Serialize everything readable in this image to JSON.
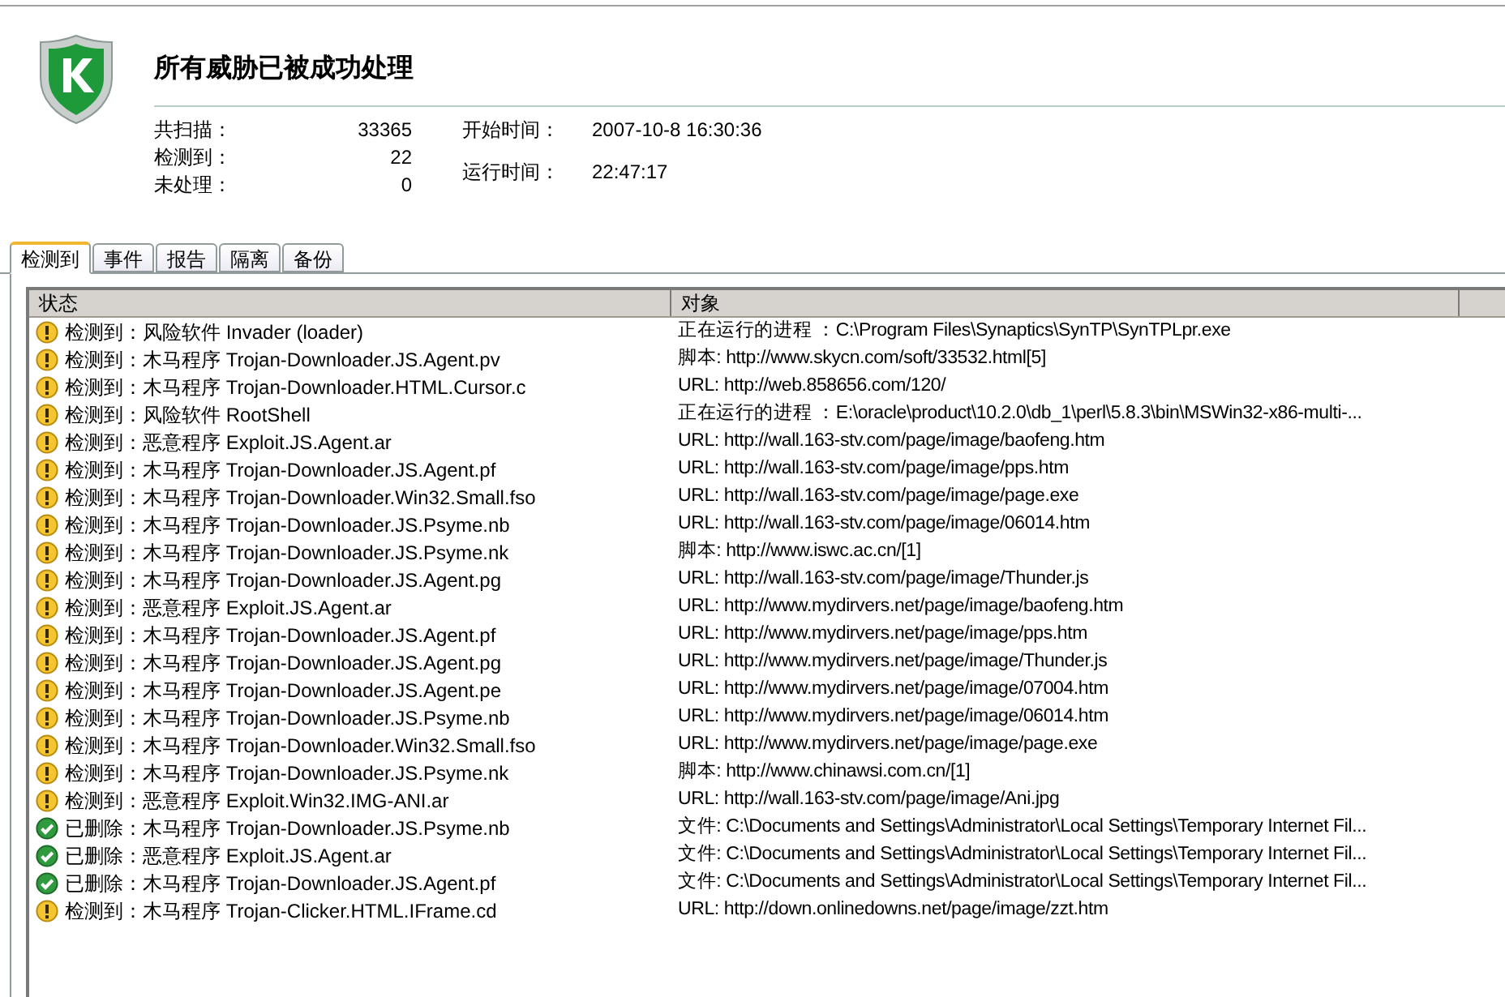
{
  "title": "所有威胁已被成功处理",
  "stats": [
    {
      "label": "共扫描：",
      "value": "33365"
    },
    {
      "label": "检测到：",
      "value": "22"
    },
    {
      "label": "未处理：",
      "value": "0"
    }
  ],
  "times": [
    {
      "label": "开始时间：",
      "value": "2007-10-8 16:30:36"
    },
    {
      "label": "运行时间：",
      "value": "22:47:17"
    }
  ],
  "tabs": [
    {
      "label": "检测到",
      "selected": true
    },
    {
      "label": "事件",
      "selected": false
    },
    {
      "label": "报告",
      "selected": false
    },
    {
      "label": "隔离",
      "selected": false
    },
    {
      "label": "备份",
      "selected": false
    }
  ],
  "table": {
    "columns": [
      "状态",
      "对象"
    ],
    "rows": [
      {
        "kind": "detected",
        "status": "检测到：风险软件 Invader (loader)",
        "object": "正在运行的进程 ：C:\\Program Files\\Synaptics\\SynTP\\SynTPLpr.exe"
      },
      {
        "kind": "detected",
        "status": "检测到：木马程序 Trojan-Downloader.JS.Agent.pv",
        "object": "脚本: http://www.skycn.com/soft/33532.html[5]"
      },
      {
        "kind": "detected",
        "status": "检测到：木马程序 Trojan-Downloader.HTML.Cursor.c",
        "object": "URL: http://web.858656.com/120/"
      },
      {
        "kind": "detected",
        "status": "检测到：风险软件 RootShell",
        "object": "正在运行的进程 ：E:\\oracle\\product\\10.2.0\\db_1\\perl\\5.8.3\\bin\\MSWin32-x86-multi-..."
      },
      {
        "kind": "detected",
        "status": "检测到：恶意程序 Exploit.JS.Agent.ar",
        "object": "URL: http://wall.163-stv.com/page/image/baofeng.htm"
      },
      {
        "kind": "detected",
        "status": "检测到：木马程序 Trojan-Downloader.JS.Agent.pf",
        "object": "URL: http://wall.163-stv.com/page/image/pps.htm"
      },
      {
        "kind": "detected",
        "status": "检测到：木马程序 Trojan-Downloader.Win32.Small.fso",
        "object": "URL: http://wall.163-stv.com/page/image/page.exe"
      },
      {
        "kind": "detected",
        "status": "检测到：木马程序 Trojan-Downloader.JS.Psyme.nb",
        "object": "URL: http://wall.163-stv.com/page/image/06014.htm"
      },
      {
        "kind": "detected",
        "status": "检测到：木马程序 Trojan-Downloader.JS.Psyme.nk",
        "object": "脚本: http://www.iswc.ac.cn/[1]"
      },
      {
        "kind": "detected",
        "status": "检测到：木马程序 Trojan-Downloader.JS.Agent.pg",
        "object": "URL: http://wall.163-stv.com/page/image/Thunder.js"
      },
      {
        "kind": "detected",
        "status": "检测到：恶意程序 Exploit.JS.Agent.ar",
        "object": "URL: http://www.mydirvers.net/page/image/baofeng.htm"
      },
      {
        "kind": "detected",
        "status": "检测到：木马程序 Trojan-Downloader.JS.Agent.pf",
        "object": "URL: http://www.mydirvers.net/page/image/pps.htm"
      },
      {
        "kind": "detected",
        "status": "检测到：木马程序 Trojan-Downloader.JS.Agent.pg",
        "object": "URL: http://www.mydirvers.net/page/image/Thunder.js"
      },
      {
        "kind": "detected",
        "status": "检测到：木马程序 Trojan-Downloader.JS.Agent.pe",
        "object": "URL: http://www.mydirvers.net/page/image/07004.htm"
      },
      {
        "kind": "detected",
        "status": "检测到：木马程序 Trojan-Downloader.JS.Psyme.nb",
        "object": "URL: http://www.mydirvers.net/page/image/06014.htm"
      },
      {
        "kind": "detected",
        "status": "检测到：木马程序 Trojan-Downloader.Win32.Small.fso",
        "object": "URL: http://www.mydirvers.net/page/image/page.exe"
      },
      {
        "kind": "detected",
        "status": "检测到：木马程序 Trojan-Downloader.JS.Psyme.nk",
        "object": "脚本: http://www.chinawsi.com.cn/[1]"
      },
      {
        "kind": "detected",
        "status": "检测到：恶意程序 Exploit.Win32.IMG-ANI.ar",
        "object": "URL: http://wall.163-stv.com/page/image/Ani.jpg"
      },
      {
        "kind": "deleted",
        "status": "已删除：木马程序 Trojan-Downloader.JS.Psyme.nb",
        "object": "文件: C:\\Documents and Settings\\Administrator\\Local Settings\\Temporary Internet Fil..."
      },
      {
        "kind": "deleted",
        "status": "已删除：恶意程序 Exploit.JS.Agent.ar",
        "object": "文件: C:\\Documents and Settings\\Administrator\\Local Settings\\Temporary Internet Fil..."
      },
      {
        "kind": "deleted",
        "status": "已删除：木马程序 Trojan-Downloader.JS.Agent.pf",
        "object": "文件: C:\\Documents and Settings\\Administrator\\Local Settings\\Temporary Internet Fil..."
      },
      {
        "kind": "detected",
        "status": "检测到：木马程序 Trojan-Clicker.HTML.IFrame.cd",
        "object": "URL: http://down.onlinedowns.net/page/image/zzt.htm"
      }
    ]
  }
}
